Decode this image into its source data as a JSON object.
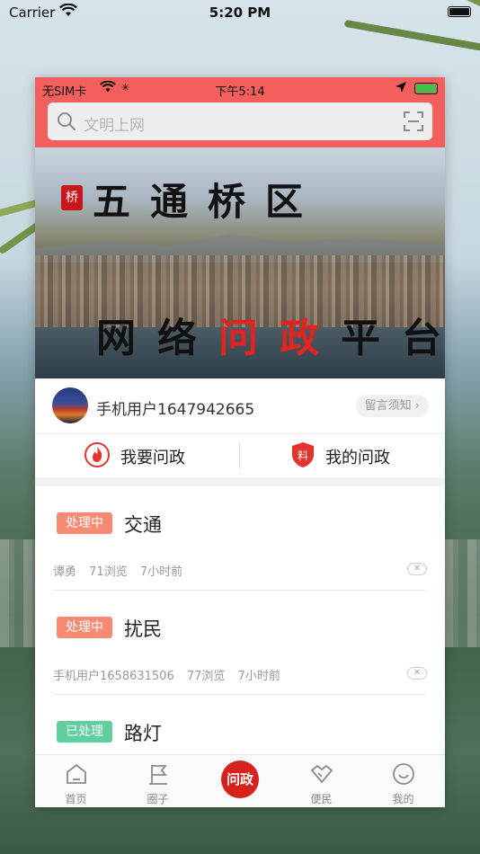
{
  "outer_status": {
    "carrier": "Carrier",
    "time": "5:20 PM"
  },
  "inner_status": {
    "carrier": "无SIM卡",
    "time": "下午5:14"
  },
  "search": {
    "placeholder": "文明上网"
  },
  "banner": {
    "seal": "桥",
    "line1": "五通桥区",
    "line2": [
      "网",
      "络",
      "问",
      "政",
      "平",
      "台"
    ],
    "line2_red_indices": [
      2,
      3
    ]
  },
  "user": {
    "name": "手机用户1647942665",
    "notice_label": "留言须知"
  },
  "actions": [
    {
      "label": "我要问政",
      "icon": "fire-icon"
    },
    {
      "label": "我的问政",
      "icon": "shield-icon",
      "icon_text": "料"
    }
  ],
  "posts": [
    {
      "status": "处理中",
      "status_color": "#f78a72",
      "title": "交通",
      "author": "谭勇",
      "views": "71浏览",
      "time": "7小时前"
    },
    {
      "status": "处理中",
      "status_color": "#f78a72",
      "title": "扰民",
      "author": "手机用户1658631506",
      "views": "77浏览",
      "time": "7小时前"
    },
    {
      "status": "已处理",
      "status_color": "#5fcf9f",
      "title": "路灯",
      "author": "",
      "views": "",
      "time": ""
    }
  ],
  "tabs": [
    {
      "label": "首页",
      "icon": "home-icon"
    },
    {
      "label": "圈子",
      "icon": "flag-icon"
    },
    {
      "label": "问政",
      "icon": "wenzheng-logo",
      "active": true
    },
    {
      "label": "便民",
      "icon": "handshake-icon"
    },
    {
      "label": "我的",
      "icon": "smile-icon"
    }
  ],
  "colors": {
    "header": "#f25f5c",
    "accent": "#d7211b",
    "processing": "#f78a72",
    "done": "#5fcf9f"
  }
}
